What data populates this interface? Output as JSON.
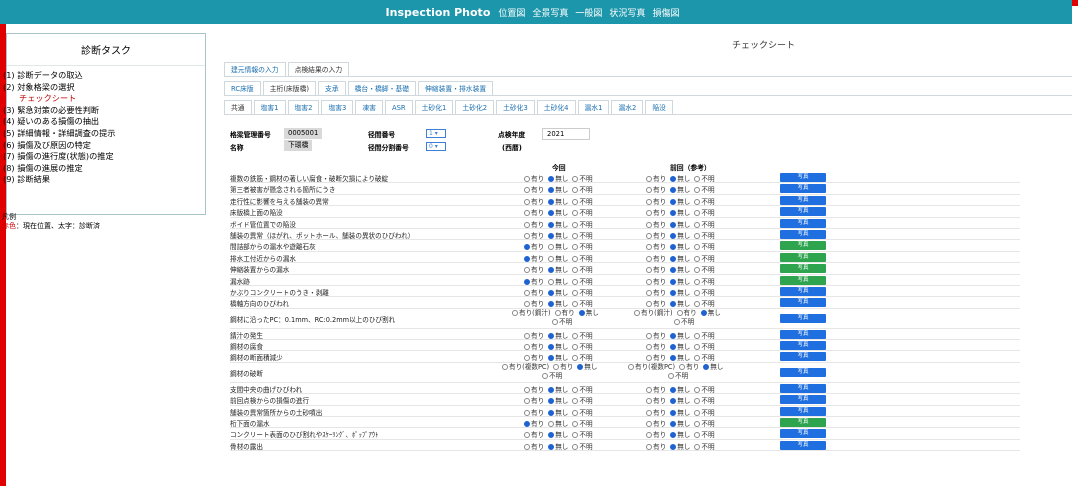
{
  "header": {
    "brand": "Inspection Photo",
    "nav": [
      "位置図",
      "全景写真",
      "一般図",
      "状況写真",
      "損傷図"
    ]
  },
  "sidebar": {
    "title": "診断タスク",
    "items": [
      {
        "label": "(1) 診断データの取込",
        "current": false
      },
      {
        "label": "(2) 対象格梁の選択",
        "current": false
      },
      {
        "label": "チェックシート",
        "current": true
      },
      {
        "label": "(3) 緊急対策の必要性判断",
        "current": false
      },
      {
        "label": "(4) 疑いのある損傷の抽出",
        "current": false
      },
      {
        "label": "(5) 詳細情報・詳細調査の提示",
        "current": false
      },
      {
        "label": "(6) 損傷及び原因の特定",
        "current": false
      },
      {
        "label": "(7) 損傷の進行度(状態)の推定",
        "current": false
      },
      {
        "label": "(8) 損傷の進展の推定",
        "current": false
      },
      {
        "label": "(9) 診断結果",
        "current": false
      }
    ],
    "legend_title": "凡例",
    "legend_red": "赤色",
    "legend_rest": "：現在位置、太字：診断済"
  },
  "main": {
    "sheet_title": "チェックシート",
    "tabs1": [
      "建元情報の入力",
      "点検結果の入力"
    ],
    "tabs2": [
      "RC床版",
      "主桁(床版橋)",
      "支承",
      "橋台・橋脚・基礎",
      "伸縮装置・排水装置"
    ],
    "tabs3": [
      "共通",
      "塩害1",
      "塩害2",
      "塩害3",
      "凍害",
      "ASR",
      "土砂化1",
      "土砂化2",
      "土砂化3",
      "土砂化4",
      "漏水1",
      "漏水2",
      "陥没"
    ],
    "info": {
      "bridge_no_label": "格梁管理番号",
      "bridge_no": "0005001",
      "name_label": "名称",
      "name": "下環橋",
      "span_label": "径間番号",
      "span_val": "1",
      "split_label": "径間分割番号",
      "split_val": "0",
      "year_label": "点検年度",
      "year_sub": "(西暦)",
      "year_val": "2021"
    },
    "col_now": "今回",
    "col_prev": "前回（参考）",
    "photo_label": "写真"
  },
  "options3": [
    "有り",
    "無し",
    "不明"
  ],
  "options_crack": [
    "有り(鋼汁)",
    "有り",
    "無し",
    "不明"
  ],
  "options_break": [
    "有り(複数PC)",
    "有り",
    "無し",
    "不明"
  ],
  "rows": [
    {
      "label": "複数の鉄筋・鋼材の著しい腐食・破断欠損により破綻",
      "now": 1,
      "prev": 1,
      "type": "3",
      "green": false
    },
    {
      "label": "第三者被害が懸念される箇所にうき",
      "now": 1,
      "prev": 1,
      "type": "3",
      "green": false
    },
    {
      "label": "走行性に影響を与える舗装の異常",
      "now": 1,
      "prev": 1,
      "type": "3",
      "green": false
    },
    {
      "label": "床版橋上面の陥没",
      "now": 1,
      "prev": 1,
      "type": "3",
      "green": false
    },
    {
      "label": "ボイド管位置での陥没",
      "now": 1,
      "prev": 1,
      "type": "3",
      "green": false
    },
    {
      "label": "舗装の異常（ほがれ、ポットホール、舗装の異状のひびわれ）",
      "now": 1,
      "prev": 1,
      "type": "3",
      "green": false
    },
    {
      "label": "間詰部からの漏水や遊離石灰",
      "now": 0,
      "prev": 1,
      "type": "3",
      "green": true
    },
    {
      "label": "排水工付近からの漏水",
      "now": 0,
      "prev": 1,
      "type": "3",
      "green": true
    },
    {
      "label": "伸縮装置からの漏水",
      "now": 1,
      "prev": 1,
      "type": "3",
      "green": true
    },
    {
      "label": "漏水跡",
      "now": 0,
      "prev": 1,
      "type": "3",
      "green": true
    },
    {
      "label": "かぶりコンクリートのうき・剥離",
      "now": 1,
      "prev": 1,
      "type": "3",
      "green": false
    },
    {
      "label": "橋軸方向のひびわれ",
      "now": 1,
      "prev": 1,
      "type": "3",
      "green": false
    },
    {
      "label": "鋼材に沿ったPC：0.1mm、RC:0.2mm以上のひび割れ",
      "now": 2,
      "prev": 2,
      "type": "crack",
      "green": false
    },
    {
      "label": "錆汁の発生",
      "now": 1,
      "prev": 1,
      "type": "3",
      "green": false
    },
    {
      "label": "鋼材の腐食",
      "now": 1,
      "prev": 1,
      "type": "3",
      "green": false
    },
    {
      "label": "鋼材の断面積減少",
      "now": 1,
      "prev": 1,
      "type": "3",
      "green": false
    },
    {
      "label": "鋼材の破断",
      "now": 2,
      "prev": 2,
      "type": "break",
      "green": false
    },
    {
      "label": "支間中央の曲げひびわれ",
      "now": 1,
      "prev": 1,
      "type": "3",
      "green": false
    },
    {
      "label": "前回点検からの損傷の進行",
      "now": 1,
      "prev": 1,
      "type": "3",
      "green": false
    },
    {
      "label": "舗装の異常箇所からの土砂噴出",
      "now": 1,
      "prev": 1,
      "type": "3",
      "green": false
    },
    {
      "label": "桁下面の漏水",
      "now": 0,
      "prev": 1,
      "type": "3",
      "green": true
    },
    {
      "label": "コンクリート表面のひび割れやｽｹｰﾘﾝｸﾞ、ﾎﾟｯﾌﾟｱｳﾄ",
      "now": 1,
      "prev": 1,
      "type": "3",
      "green": false
    },
    {
      "label": "骨材の露出",
      "now": 1,
      "prev": 1,
      "type": "3",
      "green": false
    }
  ]
}
